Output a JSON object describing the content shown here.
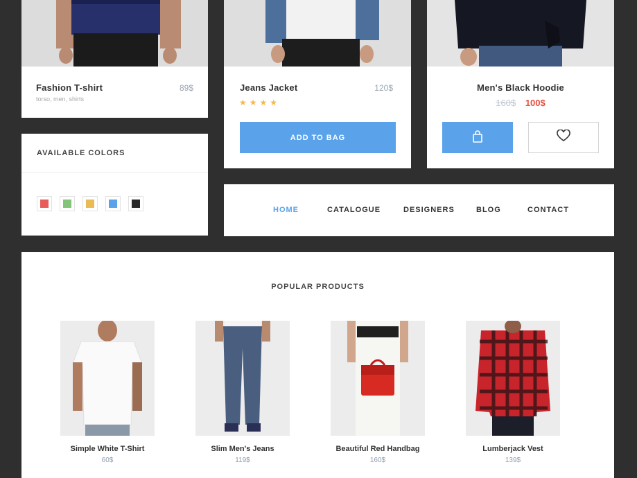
{
  "cards": {
    "tshirt": {
      "name": "Fashion T-shirt",
      "price": "89$",
      "tags": "torso, men, shirts"
    },
    "jacket": {
      "name": "Jeans Jacket",
      "price": "120$",
      "rating_stars": 4,
      "stars_text": "★★★★",
      "add_label": "ADD TO BAG"
    },
    "hoodie": {
      "name": "Men's Black Hoodie",
      "old_price": "160$",
      "new_price": "100$",
      "bag_icon": "shopping-bag-icon",
      "wish_icon": "heart-icon"
    }
  },
  "colors": {
    "title": "AVAILABLE COLORS",
    "swatches": [
      "#e85b5b",
      "#83c47a",
      "#e9bb55",
      "#5aa2ea",
      "#2a2a2a"
    ]
  },
  "nav": {
    "items": [
      "HOME",
      "CATALOGUE",
      "DESIGNERS",
      "BLOG",
      "CONTACT"
    ],
    "active": "HOME"
  },
  "popular": {
    "title": "POPULAR PRODUCTS",
    "products": [
      {
        "name": "Simple White T-Shirt",
        "price": "60$"
      },
      {
        "name": "Slim Men's Jeans",
        "price": "119$"
      },
      {
        "name": "Beautiful Red Handbag",
        "price": "160$"
      },
      {
        "name": "Lumberjack Vest",
        "price": "139$"
      }
    ]
  },
  "theme": {
    "accent": "#5aa2ea",
    "sale_red": "#e74c3c",
    "star": "#f5b84a",
    "background": "#2f2f2f"
  }
}
